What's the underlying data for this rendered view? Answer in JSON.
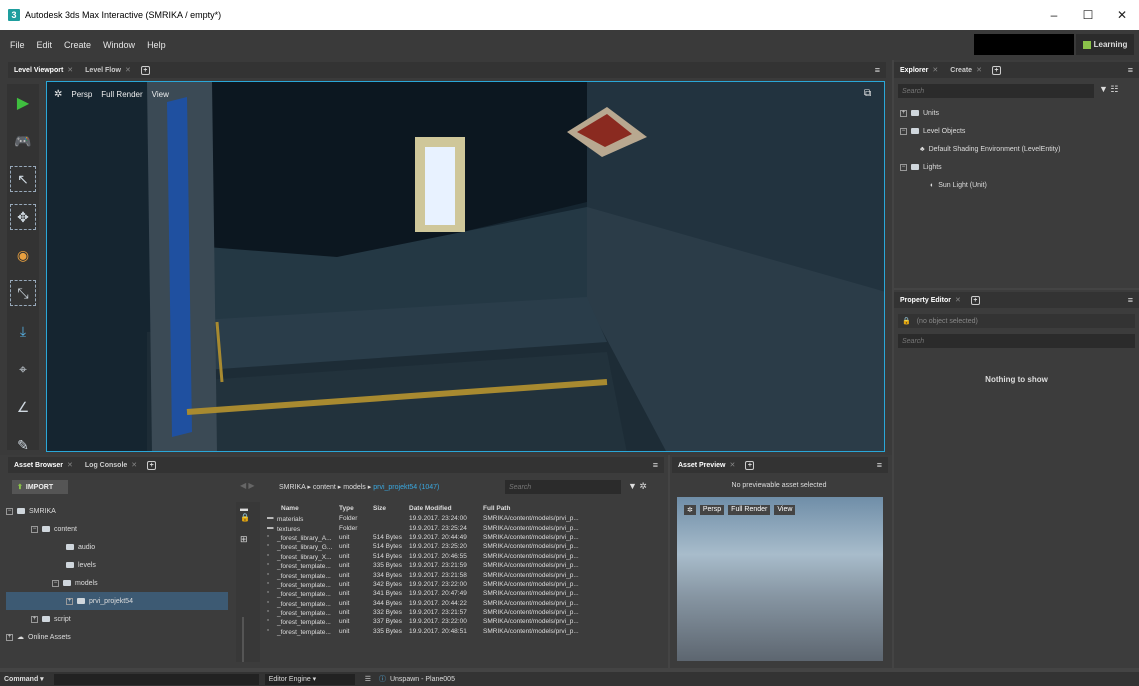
{
  "window": {
    "title": "Autodesk 3ds Max Interactive (SMRIKA / empty*)",
    "app_icon_glyph": "3",
    "minimize_glyph": "–",
    "maximize_glyph": "☐",
    "close_glyph": "✕"
  },
  "menu": {
    "items": [
      "File",
      "Edit",
      "Create",
      "Window",
      "Help"
    ],
    "learning_label": "Learning"
  },
  "viewport_tabs": {
    "tabs": [
      "Level Viewport",
      "Level Flow"
    ]
  },
  "viewport": {
    "mode": "Persp",
    "render": "Full Render",
    "view": "View"
  },
  "explorer": {
    "tabs": [
      "Explorer",
      "Create"
    ],
    "search_placeholder": "Search",
    "tree": [
      {
        "label": "Units",
        "level": 0,
        "type": "folder",
        "exp": "+"
      },
      {
        "label": "Level Objects",
        "level": 0,
        "type": "folder",
        "exp": "−"
      },
      {
        "label": "Default Shading Environment (LevelEntity)",
        "level": 1,
        "type": "entity"
      },
      {
        "label": "Lights",
        "level": 0,
        "type": "folder",
        "exp": "−"
      },
      {
        "label": "Sun Light (Unit)",
        "level": 1,
        "type": "unit"
      }
    ]
  },
  "property_editor": {
    "tab": "Property Editor",
    "selection": "(no object selected)",
    "search_placeholder": "Search",
    "empty_text": "Nothing to show"
  },
  "asset_browser": {
    "tabs": [
      "Asset Browser",
      "Log Console"
    ],
    "import_label": "IMPORT",
    "breadcrumb": [
      "SMRIKA",
      "content",
      "models"
    ],
    "breadcrumb_current": "prvi_projekt54 (1047)",
    "search_placeholder": "Search",
    "tree": [
      {
        "label": "SMRIKA",
        "level": 0,
        "exp": "−"
      },
      {
        "label": "content",
        "level": 1,
        "exp": "−"
      },
      {
        "label": "audio",
        "level": 2
      },
      {
        "label": "levels",
        "level": 2
      },
      {
        "label": "models",
        "level": 2,
        "exp": "−"
      },
      {
        "label": "prvi_projekt54",
        "level": 3,
        "exp": "+",
        "selected": true
      },
      {
        "label": "script",
        "level": 1,
        "exp": "+"
      },
      {
        "label": "Online Assets",
        "level": 0,
        "exp": "+",
        "cloud": true
      }
    ],
    "columns": [
      "Name",
      "Type",
      "Size",
      "Date Modified",
      "Full Path"
    ],
    "rows": [
      {
        "name": "materials",
        "type": "Folder",
        "size": "",
        "date": "19.9.2017. 23:24:00",
        "path": "SMRIKA/content/models/prvi_p..."
      },
      {
        "name": "textures",
        "type": "Folder",
        "size": "",
        "date": "19.9.2017. 23:25:24",
        "path": "SMRIKA/content/models/prvi_p..."
      },
      {
        "name": "_forest_library_A...",
        "type": "unit",
        "size": "514 Bytes",
        "date": "19.9.2017. 20:44:49",
        "path": "SMRIKA/content/models/prvi_p..."
      },
      {
        "name": "_forest_library_G...",
        "type": "unit",
        "size": "514 Bytes",
        "date": "19.9.2017. 23:25:20",
        "path": "SMRIKA/content/models/prvi_p..."
      },
      {
        "name": "_forest_library_X...",
        "type": "unit",
        "size": "514 Bytes",
        "date": "19.9.2017. 20:46:55",
        "path": "SMRIKA/content/models/prvi_p..."
      },
      {
        "name": "_forest_template...",
        "type": "unit",
        "size": "335 Bytes",
        "date": "19.9.2017. 23:21:59",
        "path": "SMRIKA/content/models/prvi_p..."
      },
      {
        "name": "_forest_template...",
        "type": "unit",
        "size": "334 Bytes",
        "date": "19.9.2017. 23:21:58",
        "path": "SMRIKA/content/models/prvi_p..."
      },
      {
        "name": "_forest_template...",
        "type": "unit",
        "size": "342 Bytes",
        "date": "19.9.2017. 23:22:00",
        "path": "SMRIKA/content/models/prvi_p..."
      },
      {
        "name": "_forest_template...",
        "type": "unit",
        "size": "341 Bytes",
        "date": "19.9.2017. 20:47:49",
        "path": "SMRIKA/content/models/prvi_p..."
      },
      {
        "name": "_forest_template...",
        "type": "unit",
        "size": "344 Bytes",
        "date": "19.9.2017. 20:44:22",
        "path": "SMRIKA/content/models/prvi_p..."
      },
      {
        "name": "_forest_template...",
        "type": "unit",
        "size": "332 Bytes",
        "date": "19.9.2017. 23:21:57",
        "path": "SMRIKA/content/models/prvi_p..."
      },
      {
        "name": "_forest_template...",
        "type": "unit",
        "size": "337 Bytes",
        "date": "19.9.2017. 23:22:00",
        "path": "SMRIKA/content/models/prvi_p..."
      },
      {
        "name": "_forest_template...",
        "type": "unit",
        "size": "335 Bytes",
        "date": "19.9.2017. 20:48:51",
        "path": "SMRIKA/content/models/prvi_p..."
      }
    ]
  },
  "asset_preview": {
    "tab": "Asset Preview",
    "message": "No previewable asset selected",
    "mode": "Persp",
    "render": "Full Render",
    "view": "View"
  },
  "statusbar": {
    "command_label": "Command",
    "engine": "Editor Engine",
    "message": "Unspawn - Plane005"
  },
  "colors": {
    "accent": "#2aa7d8",
    "play": "#3fbf3f",
    "learning": "#8bc34a"
  }
}
